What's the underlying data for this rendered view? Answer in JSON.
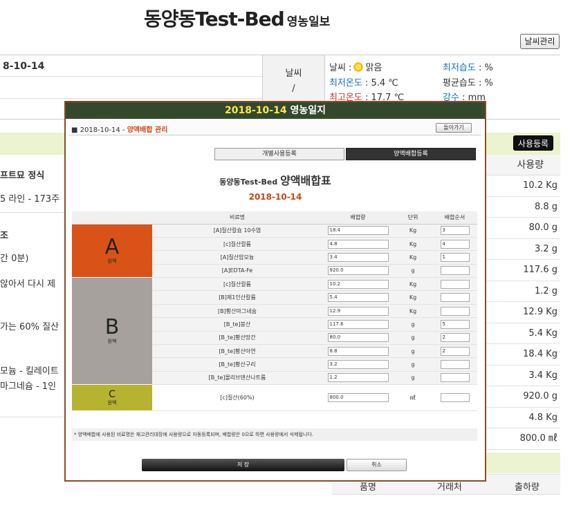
{
  "page": {
    "title": "동양동Test-Bed",
    "title_sub": "영농일보",
    "weather_manage_btn": "날씨관리",
    "date_fragment": "8-10-14",
    "weather_cell_label": "날씨",
    "weather_cell_slash": "/",
    "weather": {
      "sky_label": "날씨 :",
      "sky_value": "맑음",
      "min_temp_label": "최저온도",
      "min_temp_value": ": 5.4 ℃",
      "max_temp_label": "최고온도",
      "max_temp_value": ": 17.7 ℃",
      "min_hum_label": "최저습도",
      "min_hum_value": ": %",
      "avg_hum_label": "평균습도",
      "avg_hum_value": ": %",
      "rain_label": "강수",
      "rain_value": ": mm"
    },
    "use_register_btn": "사용등록",
    "left_fragments": [
      "프트묘 정식",
      "5 라인 - 173주",
      "조",
      "간 0분)",
      "않아서 다시 제",
      "가는 60% 질산",
      "모늄 - 킬레이트",
      "마그네슘 - 1인"
    ],
    "usage_header": "사용량",
    "usage_values": [
      "10.2 Kg",
      "8.8 g",
      "80.0 g",
      "3.2 g",
      "117.6 g",
      "1.2 g",
      "12.9 Kg",
      "5.4 Kg",
      "18.4 Kg",
      "3.4 Kg",
      "920.0 g",
      "4.8 Kg",
      "800.0 ㎖"
    ],
    "bottom_headers": [
      "품명",
      "거래처",
      "출하량"
    ]
  },
  "modal": {
    "title_date": "2018-10-14",
    "title_text": "영농일지",
    "breadcrumb_prefix": "■ 2018-10-14 -",
    "breadcrumb_page": "양액배합 관리",
    "back_btn": "돌아가기",
    "tab_individual": "개별사용등록",
    "tab_mix": "양액배합등록",
    "sheet_prefix": "동양동Test-Bed",
    "sheet_title": "양액배합표",
    "sheet_date": "2018-10-14",
    "col_fert": "비료명",
    "col_amount": "배합량",
    "col_unit": "단위",
    "col_order": "배합순서",
    "groups": [
      {
        "letter": "A",
        "label": "원액",
        "color": "#d95319"
      },
      {
        "letter": "B",
        "label": "원액",
        "color": "#a6a19c"
      },
      {
        "letter": "C",
        "label": "원액",
        "color": "#b5b330"
      }
    ],
    "rows": [
      {
        "name": "[A]질산칼슘 10수염",
        "amount": "18.4",
        "unit": "Kg",
        "order": "3"
      },
      {
        "name": "[c]질산칼륨",
        "amount": "4.8",
        "unit": "Kg",
        "order": "4"
      },
      {
        "name": "[A]질산암모늄",
        "amount": "3.4",
        "unit": "Kg",
        "order": "1"
      },
      {
        "name": "[A]EDTA-Fe",
        "amount": "920.0",
        "unit": "g",
        "order": ""
      },
      {
        "name": "[c]질산칼륨",
        "amount": "10.2",
        "unit": "Kg",
        "order": ""
      },
      {
        "name": "[B]제1인산칼륨",
        "amount": "5.4",
        "unit": "Kg",
        "order": ""
      },
      {
        "name": "[B]황산마그네슘",
        "amount": "12.9",
        "unit": "Kg",
        "order": ""
      },
      {
        "name": "[B_te]붕산",
        "amount": "117.6",
        "unit": "g",
        "order": "5"
      },
      {
        "name": "[B_te]황산망간",
        "amount": "80.0",
        "unit": "g",
        "order": "2"
      },
      {
        "name": "[B_te]황산아연",
        "amount": "8.8",
        "unit": "g",
        "order": "2"
      },
      {
        "name": "[B_te]황산구리",
        "amount": "3.2",
        "unit": "g",
        "order": ""
      },
      {
        "name": "[B_te]몰리브덴산나트륨",
        "amount": "1.2",
        "unit": "g",
        "order": ""
      },
      {
        "name": "[c]질산(60%)",
        "amount": "800.0",
        "unit": "㎖",
        "order": ""
      }
    ],
    "note": "* 양액배합에 사용된 비료명은 재고관리대장에 사용량으로 자동등록되며, 배합량은 0으로 하면 사용량에서 삭제됩니다.",
    "save_btn": "저 장",
    "cancel_btn": "취소"
  }
}
